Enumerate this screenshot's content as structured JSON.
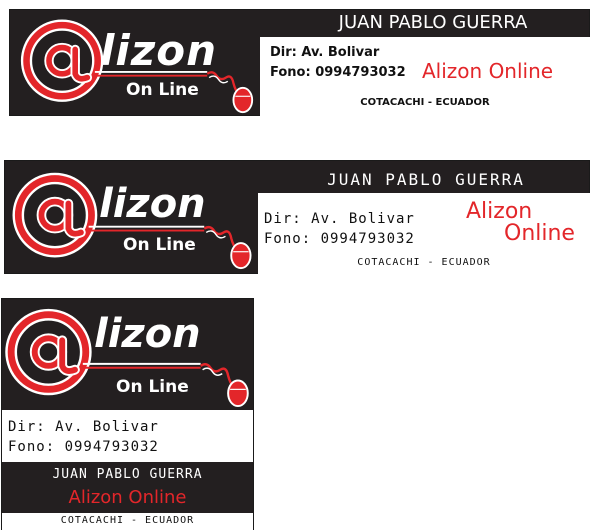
{
  "colors": {
    "background": "#231f20",
    "accent": "#e3262a",
    "text_light": "#ffffff",
    "text_dark": "#111111"
  },
  "logo": {
    "word": "lizon",
    "at_symbol": "@",
    "tagline": "On Line"
  },
  "cards": [
    {
      "name": "JUAN PABLO GUERRA",
      "address": "Dir: Av. Bolivar",
      "phone": "Fono: 0994793032",
      "brand": "Alizon Online",
      "city": "COTACACHI - ECUADOR"
    },
    {
      "name": "JUAN PABLO GUERRA",
      "address": "Dir: Av. Bolivar",
      "phone": "Fono: 0994793032",
      "brand_line1": "Alizon",
      "brand_line2": "Online",
      "city": "COTACACHI - ECUADOR"
    },
    {
      "name": "JUAN PABLO GUERRA",
      "address": "Dir: Av. Bolivar",
      "phone": "Fono: 0994793032",
      "brand": "Alizon Online",
      "city": "COTACACHI - ECUADOR"
    }
  ]
}
